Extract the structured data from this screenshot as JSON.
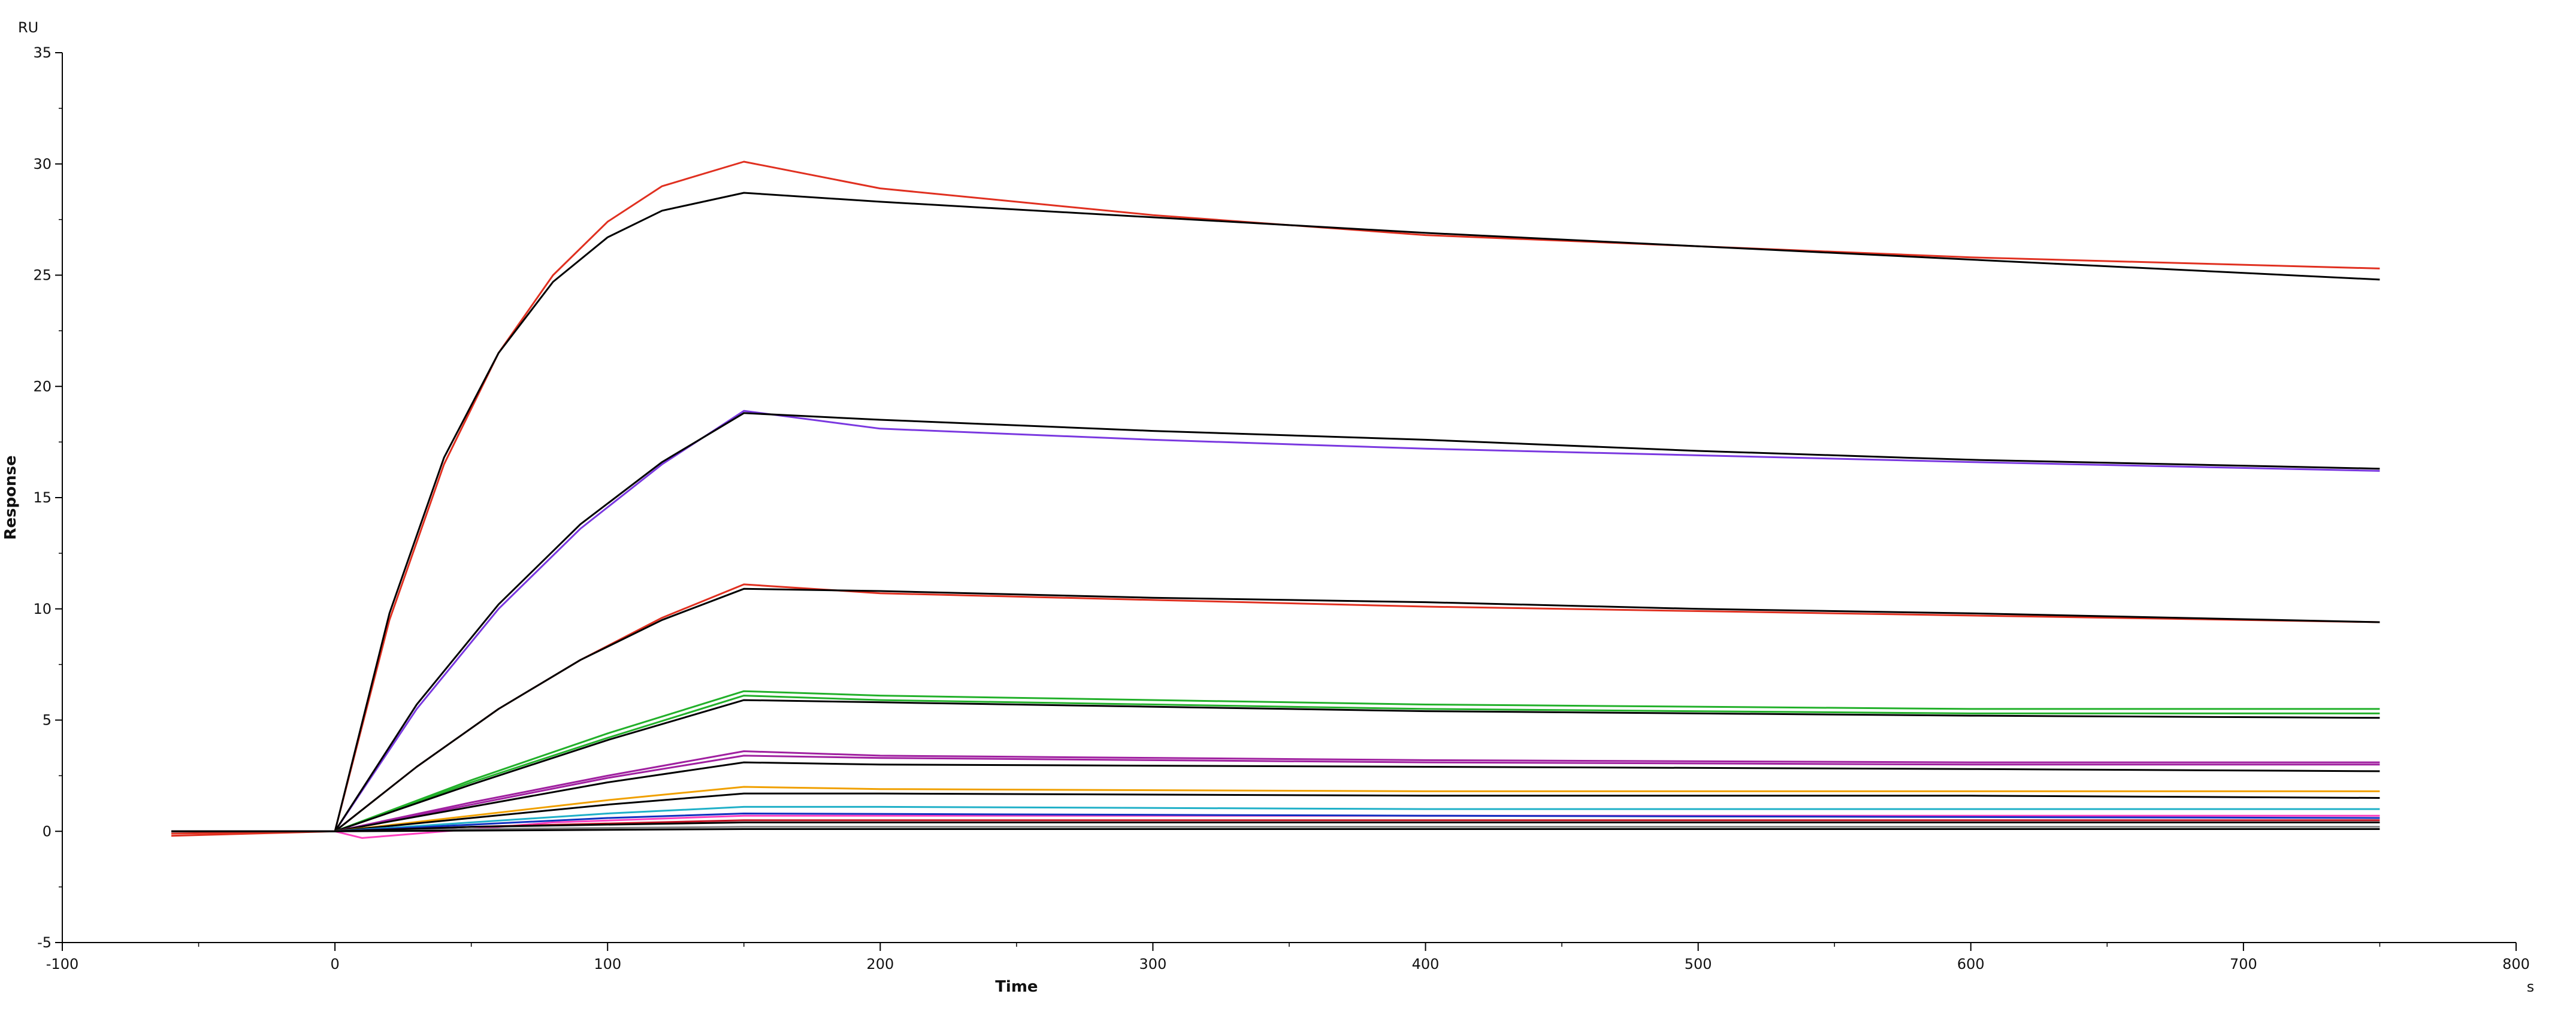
{
  "chart_data": {
    "type": "line",
    "title": "",
    "xlabel": "Time",
    "ylabel": "Response",
    "x_unit": "s",
    "y_unit": "RU",
    "xlim": [
      -100,
      800
    ],
    "ylim": [
      -5,
      35
    ],
    "x_ticks": [
      -100,
      0,
      100,
      200,
      300,
      400,
      500,
      600,
      700,
      800
    ],
    "y_ticks": [
      -5,
      0,
      5,
      10,
      15,
      20,
      25,
      30,
      35
    ],
    "grid": false,
    "legend": "none",
    "series": [
      {
        "color": "#e03020",
        "values": [
          [
            -60,
            -0.2
          ],
          [
            0,
            0
          ],
          [
            20,
            9.5
          ],
          [
            40,
            16.5
          ],
          [
            60,
            21.5
          ],
          [
            80,
            25.0
          ],
          [
            100,
            27.4
          ],
          [
            120,
            29.0
          ],
          [
            150,
            30.1
          ],
          [
            200,
            28.9
          ],
          [
            300,
            27.7
          ],
          [
            400,
            26.8
          ],
          [
            500,
            26.3
          ],
          [
            600,
            25.8
          ],
          [
            750,
            25.3
          ]
        ]
      },
      {
        "color": "#000000",
        "values": [
          [
            -60,
            0
          ],
          [
            0,
            0
          ],
          [
            20,
            9.8
          ],
          [
            40,
            16.8
          ],
          [
            60,
            21.5
          ],
          [
            80,
            24.7
          ],
          [
            100,
            26.7
          ],
          [
            120,
            27.9
          ],
          [
            150,
            28.7
          ],
          [
            200,
            28.3
          ],
          [
            300,
            27.6
          ],
          [
            400,
            26.9
          ],
          [
            500,
            26.3
          ],
          [
            600,
            25.7
          ],
          [
            750,
            24.8
          ]
        ]
      },
      {
        "color": "#7a38e0",
        "values": [
          [
            -60,
            0
          ],
          [
            0,
            0
          ],
          [
            30,
            5.5
          ],
          [
            60,
            10.0
          ],
          [
            90,
            13.6
          ],
          [
            120,
            16.5
          ],
          [
            150,
            18.9
          ],
          [
            200,
            18.1
          ],
          [
            300,
            17.6
          ],
          [
            400,
            17.2
          ],
          [
            500,
            16.9
          ],
          [
            600,
            16.6
          ],
          [
            750,
            16.2
          ]
        ]
      },
      {
        "color": "#000000",
        "values": [
          [
            -60,
            0
          ],
          [
            0,
            0
          ],
          [
            30,
            5.7
          ],
          [
            60,
            10.2
          ],
          [
            90,
            13.8
          ],
          [
            120,
            16.6
          ],
          [
            150,
            18.8
          ],
          [
            200,
            18.5
          ],
          [
            300,
            18.0
          ],
          [
            400,
            17.6
          ],
          [
            500,
            17.1
          ],
          [
            600,
            16.7
          ],
          [
            750,
            16.3
          ]
        ]
      },
      {
        "color": "#e03020",
        "values": [
          [
            -60,
            -0.1
          ],
          [
            0,
            0
          ],
          [
            30,
            2.9
          ],
          [
            60,
            5.5
          ],
          [
            90,
            7.7
          ],
          [
            120,
            9.6
          ],
          [
            150,
            11.1
          ],
          [
            200,
            10.7
          ],
          [
            300,
            10.4
          ],
          [
            400,
            10.1
          ],
          [
            500,
            9.9
          ],
          [
            600,
            9.7
          ],
          [
            750,
            9.4
          ]
        ]
      },
      {
        "color": "#000000",
        "values": [
          [
            -60,
            0
          ],
          [
            0,
            0
          ],
          [
            30,
            2.9
          ],
          [
            60,
            5.5
          ],
          [
            90,
            7.7
          ],
          [
            120,
            9.5
          ],
          [
            150,
            10.9
          ],
          [
            200,
            10.8
          ],
          [
            300,
            10.5
          ],
          [
            400,
            10.3
          ],
          [
            500,
            10.0
          ],
          [
            600,
            9.8
          ],
          [
            750,
            9.4
          ]
        ]
      },
      {
        "color": "#22b02a",
        "values": [
          [
            -60,
            0
          ],
          [
            0,
            0
          ],
          [
            50,
            2.3
          ],
          [
            100,
            4.4
          ],
          [
            150,
            6.3
          ],
          [
            200,
            6.1
          ],
          [
            400,
            5.7
          ],
          [
            600,
            5.5
          ],
          [
            750,
            5.5
          ]
        ]
      },
      {
        "color": "#22b02a",
        "values": [
          [
            -60,
            0
          ],
          [
            0,
            0
          ],
          [
            50,
            2.2
          ],
          [
            100,
            4.2
          ],
          [
            150,
            6.1
          ],
          [
            200,
            5.9
          ],
          [
            400,
            5.5
          ],
          [
            600,
            5.3
          ],
          [
            750,
            5.3
          ]
        ]
      },
      {
        "color": "#000000",
        "values": [
          [
            -60,
            0
          ],
          [
            0,
            0
          ],
          [
            50,
            2.1
          ],
          [
            100,
            4.1
          ],
          [
            150,
            5.9
          ],
          [
            200,
            5.8
          ],
          [
            400,
            5.4
          ],
          [
            600,
            5.2
          ],
          [
            750,
            5.1
          ]
        ]
      },
      {
        "color": "#a020a0",
        "values": [
          [
            -60,
            0
          ],
          [
            0,
            0
          ],
          [
            50,
            1.3
          ],
          [
            100,
            2.5
          ],
          [
            150,
            3.6
          ],
          [
            200,
            3.4
          ],
          [
            400,
            3.2
          ],
          [
            600,
            3.1
          ],
          [
            750,
            3.1
          ]
        ]
      },
      {
        "color": "#a020a0",
        "values": [
          [
            -60,
            0
          ],
          [
            0,
            0
          ],
          [
            50,
            1.2
          ],
          [
            100,
            2.4
          ],
          [
            150,
            3.4
          ],
          [
            200,
            3.3
          ],
          [
            400,
            3.1
          ],
          [
            600,
            3.0
          ],
          [
            750,
            3.0
          ]
        ]
      },
      {
        "color": "#000000",
        "values": [
          [
            -60,
            0
          ],
          [
            0,
            0
          ],
          [
            50,
            1.1
          ],
          [
            100,
            2.2
          ],
          [
            150,
            3.1
          ],
          [
            200,
            3.0
          ],
          [
            400,
            2.9
          ],
          [
            600,
            2.8
          ],
          [
            750,
            2.7
          ]
        ]
      },
      {
        "color": "#f0a000",
        "values": [
          [
            -60,
            0
          ],
          [
            0,
            0
          ],
          [
            50,
            0.7
          ],
          [
            100,
            1.4
          ],
          [
            150,
            2.0
          ],
          [
            200,
            1.9
          ],
          [
            400,
            1.8
          ],
          [
            600,
            1.8
          ],
          [
            750,
            1.8
          ]
        ]
      },
      {
        "color": "#000000",
        "values": [
          [
            -60,
            0
          ],
          [
            0,
            0
          ],
          [
            50,
            0.6
          ],
          [
            100,
            1.2
          ],
          [
            150,
            1.7
          ],
          [
            200,
            1.7
          ],
          [
            400,
            1.6
          ],
          [
            600,
            1.6
          ],
          [
            750,
            1.5
          ]
        ]
      },
      {
        "color": "#20b0c8",
        "values": [
          [
            -60,
            0
          ],
          [
            0,
            0
          ],
          [
            50,
            0.4
          ],
          [
            100,
            0.8
          ],
          [
            150,
            1.1
          ],
          [
            200,
            1.1
          ],
          [
            400,
            1.0
          ],
          [
            600,
            1.0
          ],
          [
            750,
            1.0
          ]
        ]
      },
      {
        "color": "#ff40c0",
        "values": [
          [
            -60,
            0
          ],
          [
            0,
            0
          ],
          [
            10,
            -0.3
          ],
          [
            30,
            -0.1
          ],
          [
            80,
            0.4
          ],
          [
            150,
            0.7
          ],
          [
            400,
            0.7
          ],
          [
            750,
            0.7
          ]
        ]
      },
      {
        "color": "#1030c0",
        "values": [
          [
            -60,
            0
          ],
          [
            0,
            0
          ],
          [
            50,
            0.3
          ],
          [
            100,
            0.6
          ],
          [
            150,
            0.8
          ],
          [
            400,
            0.7
          ],
          [
            750,
            0.6
          ]
        ]
      },
      {
        "color": "#c01020",
        "values": [
          [
            -60,
            0
          ],
          [
            0,
            0
          ],
          [
            50,
            0.2
          ],
          [
            150,
            0.5
          ],
          [
            400,
            0.5
          ],
          [
            750,
            0.5
          ]
        ]
      },
      {
        "color": "#808080",
        "values": [
          [
            -60,
            0
          ],
          [
            0,
            0
          ],
          [
            50,
            0.1
          ],
          [
            150,
            0.2
          ],
          [
            400,
            0.2
          ],
          [
            750,
            0.2
          ]
        ]
      },
      {
        "color": "#000000",
        "values": [
          [
            -60,
            0
          ],
          [
            0,
            0
          ],
          [
            150,
            0.1
          ],
          [
            400,
            0.1
          ],
          [
            750,
            0.1
          ]
        ]
      },
      {
        "color": "#000000",
        "values": [
          [
            -60,
            0
          ],
          [
            0,
            0
          ],
          [
            50,
            0.2
          ],
          [
            150,
            0.4
          ],
          [
            400,
            0.4
          ],
          [
            750,
            0.4
          ]
        ]
      }
    ]
  }
}
